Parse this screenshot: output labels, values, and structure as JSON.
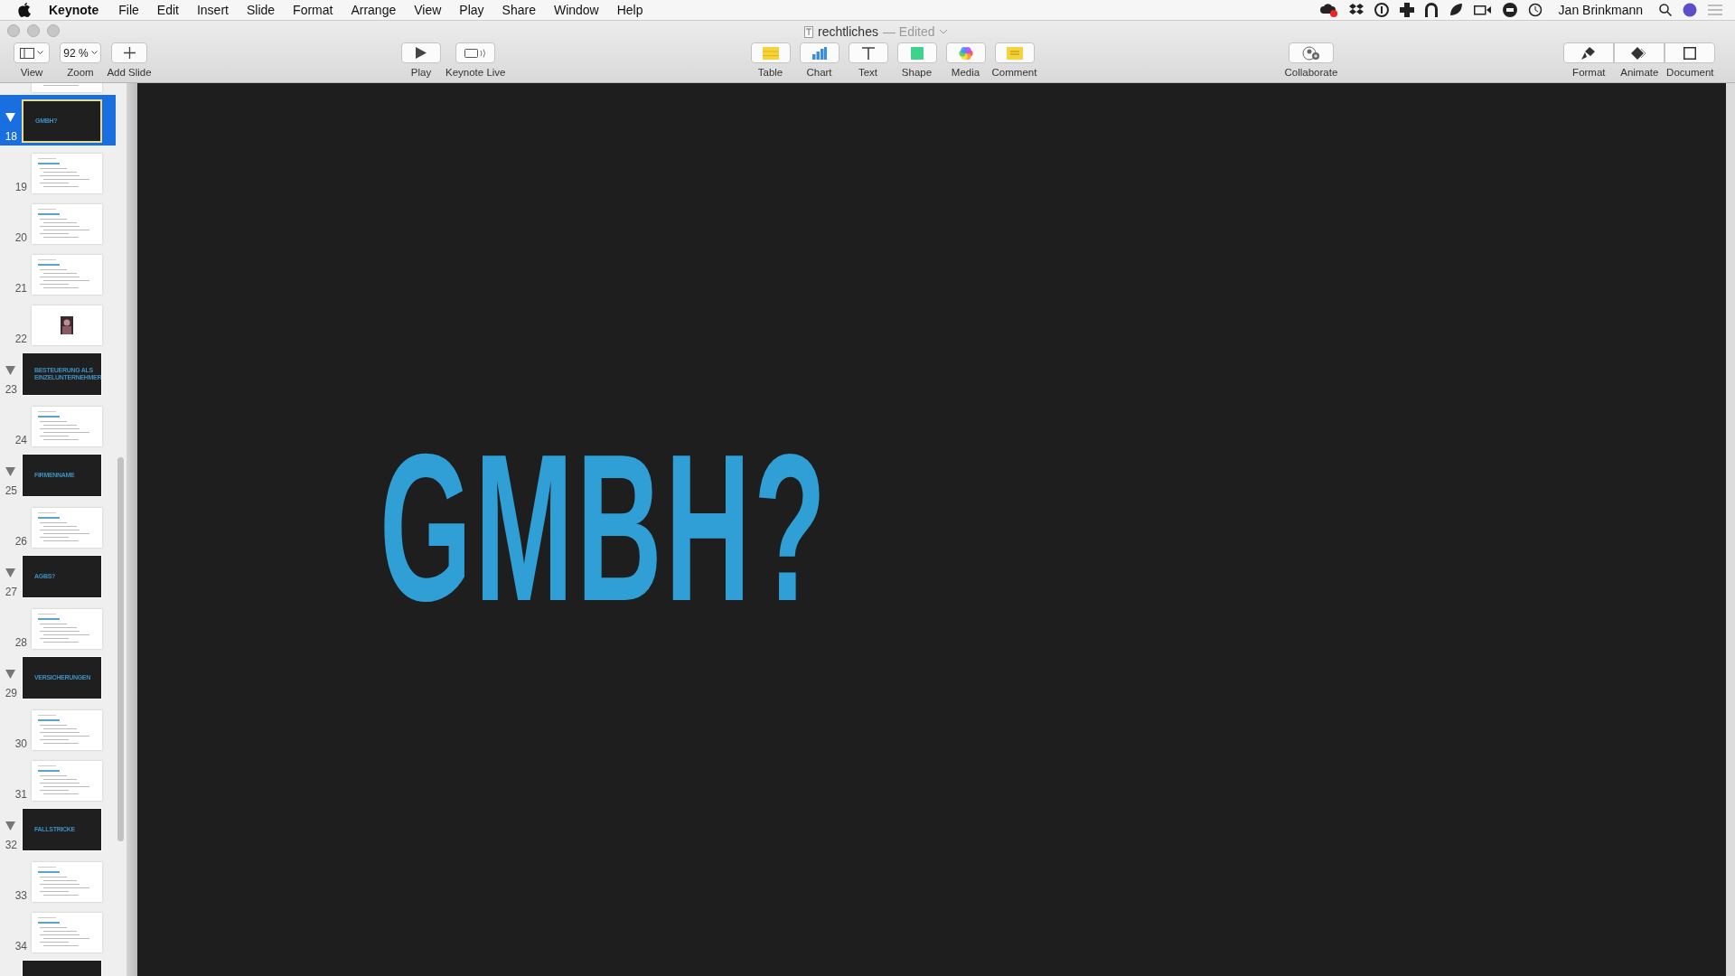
{
  "menubar": {
    "menus": [
      {
        "label": "Keynote",
        "kind": "app"
      },
      {
        "label": "File",
        "kind": "menu"
      },
      {
        "label": "Edit",
        "kind": "menu"
      },
      {
        "label": "Insert",
        "kind": "menu"
      },
      {
        "label": "Slide",
        "kind": "menu"
      },
      {
        "label": "Format",
        "kind": "menu"
      },
      {
        "label": "Arrange",
        "kind": "menu"
      },
      {
        "label": "View",
        "kind": "menu"
      },
      {
        "label": "Play",
        "kind": "menu"
      },
      {
        "label": "Share",
        "kind": "menu"
      },
      {
        "label": "Window",
        "kind": "menu"
      },
      {
        "label": "Help",
        "kind": "menu"
      }
    ],
    "user": "Jan Brinkmann"
  },
  "window": {
    "title": "rechtliches",
    "status": "— Edited"
  },
  "toolbar": {
    "groups": [
      {
        "kind": "left",
        "items": [
          {
            "label": "View",
            "dropdown": true
          },
          {
            "label": "Zoom",
            "value": "92 %",
            "dropdown": true
          },
          {
            "label": "Add Slide"
          }
        ]
      },
      {
        "kind": "play",
        "items": [
          {
            "label": "Play"
          },
          {
            "label": "Keynote Live"
          }
        ]
      },
      {
        "kind": "insert",
        "items": [
          {
            "label": "Table"
          },
          {
            "label": "Chart"
          },
          {
            "label": "Text"
          },
          {
            "label": "Shape"
          },
          {
            "label": "Media"
          },
          {
            "label": "Comment"
          }
        ]
      },
      {
        "kind": "collab",
        "items": [
          {
            "label": "Collaborate"
          }
        ]
      },
      {
        "kind": "inspector",
        "items": [
          {
            "label": "Format"
          },
          {
            "label": "Animate"
          },
          {
            "label": "Document"
          }
        ]
      }
    ]
  },
  "slides": [
    {
      "kind": "content",
      "selected": false
    },
    {
      "number": "18",
      "kind": "title",
      "title": "GMBH?",
      "expanded": true,
      "selected": true
    },
    {
      "number": "19",
      "kind": "content",
      "selected": false
    },
    {
      "number": "20",
      "kind": "content",
      "selected": false
    },
    {
      "number": "21",
      "kind": "content",
      "selected": false
    },
    {
      "number": "22",
      "selected": false
    },
    {
      "number": "23",
      "kind": "title",
      "title": "BESTEUERUNG ALS EINZELUNTERNEHMER",
      "expanded": true,
      "selected": false
    },
    {
      "number": "24",
      "kind": "content",
      "selected": false
    },
    {
      "number": "25",
      "kind": "title",
      "title": "FIRMENNAME",
      "expanded": true,
      "selected": false
    },
    {
      "number": "26",
      "kind": "content",
      "selected": false
    },
    {
      "number": "27",
      "kind": "title",
      "title": "AGBS?",
      "expanded": true,
      "selected": false
    },
    {
      "number": "28",
      "kind": "content",
      "selected": false
    },
    {
      "number": "29",
      "kind": "title",
      "title": "VERSICHERUNGEN",
      "expanded": true,
      "selected": false
    },
    {
      "number": "30",
      "kind": "content",
      "selected": false
    },
    {
      "number": "31",
      "kind": "content",
      "selected": false
    },
    {
      "number": "32",
      "kind": "title",
      "title": "FALLSTRICKE",
      "expanded": true,
      "selected": false
    },
    {
      "number": "33",
      "kind": "content",
      "selected": false
    },
    {
      "number": "34",
      "kind": "content",
      "selected": false
    },
    {
      "kind": "title",
      "selected": false
    }
  ],
  "slide": {
    "title": "GMBH?"
  }
}
